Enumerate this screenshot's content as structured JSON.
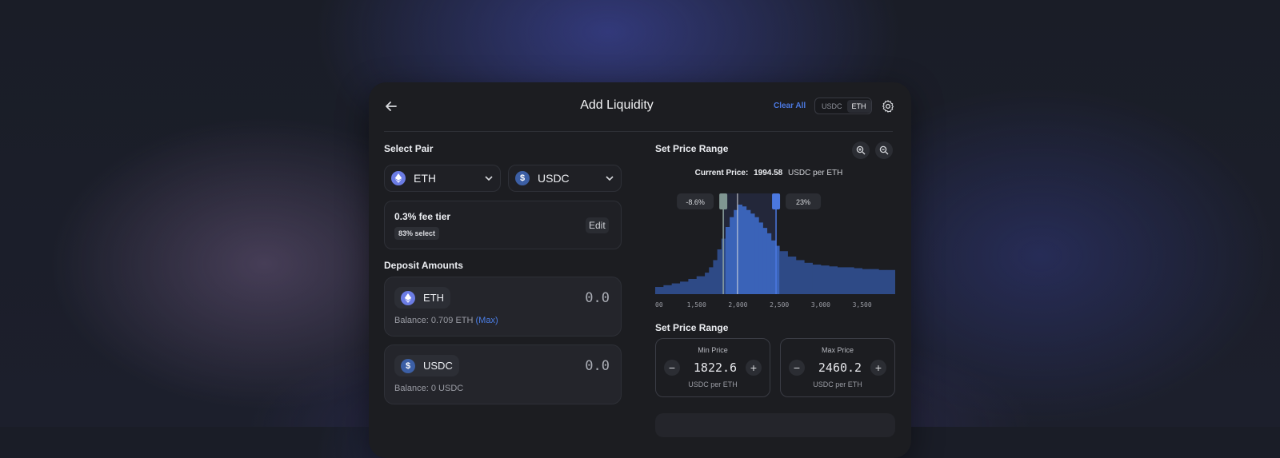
{
  "header": {
    "title": "Add Liquidity",
    "clear_all": "Clear All",
    "toggle": [
      "USDC",
      "ETH"
    ],
    "active_toggle": "ETH"
  },
  "select_pair": {
    "heading": "Select Pair",
    "token_a": "ETH",
    "token_b": "USDC",
    "fee_tier": "0.3% fee tier",
    "fee_badge": "83% select",
    "edit": "Edit"
  },
  "deposit": {
    "heading": "Deposit Amounts",
    "items": [
      {
        "token": "ETH",
        "amount": "0.0",
        "balance_prefix": "Balance: 0.709 ETH",
        "max": "(Max)"
      },
      {
        "token": "USDC",
        "amount": "0.0",
        "balance_prefix": "Balance: 0 USDC",
        "max": ""
      }
    ]
  },
  "price_range": {
    "heading": "Set Price Range",
    "current_label": "Current Price:",
    "current_value": "1994.58",
    "current_unit": "USDC per ETH",
    "lower_pct": "-8.6%",
    "upper_pct": "23%",
    "heading2": "Set Price Range",
    "min": {
      "label": "Min Price",
      "value": "1822.6",
      "unit": "USDC per ETH"
    },
    "max": {
      "label": "Max Price",
      "value": "2460.2",
      "unit": "USDC per ETH"
    }
  },
  "colors": {
    "accent": "#4b78e0",
    "range_fill": "#3a63b8",
    "histogram": "#2e4a86"
  },
  "chart_data": {
    "type": "area",
    "title": "",
    "xlabel": "",
    "ylabel": "",
    "tick_labels": [
      "00",
      "1,500",
      "2,000",
      "2,500",
      "3,000",
      "3,500"
    ],
    "x": [
      1000,
      1100,
      1200,
      1300,
      1400,
      1500,
      1600,
      1650,
      1700,
      1750,
      1800,
      1850,
      1900,
      1950,
      2000,
      2050,
      2100,
      2150,
      2200,
      2250,
      2300,
      2350,
      2400,
      2450,
      2500,
      2600,
      2700,
      2800,
      2900,
      3000,
      3100,
      3200,
      3300,
      3400,
      3500,
      3600,
      3700,
      3800,
      3900
    ],
    "y": [
      8,
      10,
      12,
      14,
      17,
      20,
      24,
      30,
      38,
      50,
      62,
      75,
      86,
      94,
      100,
      98,
      94,
      90,
      86,
      80,
      74,
      68,
      60,
      54,
      48,
      42,
      38,
      35,
      33,
      32,
      31,
      30,
      30,
      29,
      28,
      28,
      27,
      27,
      26
    ],
    "xlim": [
      1000,
      3900
    ],
    "range": [
      1822.6,
      2460.2
    ],
    "current": 1994.58
  }
}
